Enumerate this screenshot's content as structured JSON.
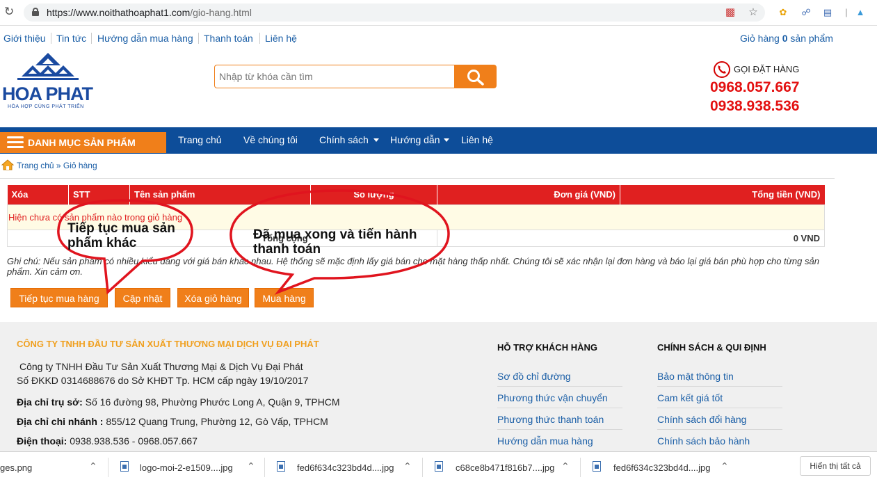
{
  "browser": {
    "url_host": "https://www.noithathoaphat1.com",
    "url_path": "/gio-hang.html"
  },
  "toplinks": {
    "items": [
      "Giới thiệu",
      "Tin tức",
      "Hướng dẫn mua hàng",
      "Thanh toán",
      "Liên hệ"
    ],
    "cart_prefix": "Giỏ hàng",
    "cart_count": "0",
    "cart_suffix": "sản phẩm"
  },
  "header": {
    "logo_brand": "HOA PHAT",
    "logo_tagline": "HÒA HỢP CÙNG PHÁT TRIỂN",
    "search_placeholder": "Nhập từ khóa cần tìm",
    "hotline_label": "GỌI ĐẶT HÀNG",
    "hotline_numbers": [
      "0968.057.667",
      "0938.938.536"
    ]
  },
  "nav": {
    "category_label": "DANH MỤC SẢN PHẨM",
    "items": [
      "Trang chủ",
      "Về chúng tôi",
      "Chính sách",
      "Hướng dẫn",
      "Liên hệ"
    ]
  },
  "breadcrumb": {
    "text": "Trang chủ » Giỏ hàng"
  },
  "cart": {
    "headers": [
      "Xóa",
      "STT",
      "Tên sản phẩm",
      "Số lượng",
      "Đơn giá (VND)",
      "Tổng tiền (VND)"
    ],
    "empty_message": "Hiện chưa có sản phẩm nào trong giỏ hàng",
    "total_label": "Tổng cộng",
    "total_value": "0 VND",
    "note": "Ghi chú: Nếu sản phẩm có nhiều kiểu dáng với giá bán khác nhau. Hệ thống sẽ mặc định lấy giá bán cho mặt hàng thấp nhất. Chúng tôi sẽ xác nhận lại đơn hàng và báo lại giá bán phù hợp cho từng sản phẩm. Xin cảm ơn.",
    "buttons": {
      "continue": "Tiếp tục mua hàng",
      "update": "Cập nhật",
      "clear": "Xóa giỏ hàng",
      "checkout": "Mua hàng"
    }
  },
  "annotations": {
    "left": "Tiếp tục mua sản phẩm khác",
    "right": "Đã mua xong và tiến hành thanh toán",
    "color": "#e0141e"
  },
  "footer": {
    "company_title": "CÔNG TY TNHH ĐẦU TƯ SẢN XUẤT THƯƠNG MẠI DỊCH VỤ ĐẠI PHÁT",
    "company_name": "Công ty TNHH Đầu Tư Sản Xuất Thương Mại & Dịch Vụ Đại Phát",
    "business_reg": "Số ĐKKD 0314688676 do Sở KHĐT Tp. HCM cấp ngày 19/10/2017",
    "hq_label": "Địa chỉ  trụ sở:",
    "hq_value": " Số 16 đường 98, Phường Phước Long A, Quận 9, TPHCM",
    "branch_label": "Địa chỉ  chi nhánh :",
    "branch_value": " 855/12 Quang Trung, Phường 12, Gò Vấp, TPHCM",
    "phone_label": "Điện thoại:",
    "phone_value": " 0938.938.536  - 0968.057.667",
    "support_title": "HỖ TRỢ KHÁCH HÀNG",
    "support_links": [
      "Sơ đồ chỉ đường",
      "Phương thức vận chuyển",
      "Phương thức thanh toán",
      "Hướng dẫn mua hàng"
    ],
    "policy_title": "CHÍNH SÁCH & QUI ĐỊNH",
    "policy_links": [
      "Bảo mật thông tin",
      "Cam kết giá tốt",
      "Chính sách đổi hàng",
      "Chính sách bảo hành"
    ]
  },
  "downloads": {
    "items": [
      "ges.png",
      "logo-moi-2-e1509....jpg",
      "fed6f634c323bd4d....jpg",
      "c68ce8b471f816b7....jpg",
      "fed6f634c323bd4d....jpg"
    ],
    "show_all": "Hiển thị tất cả"
  }
}
